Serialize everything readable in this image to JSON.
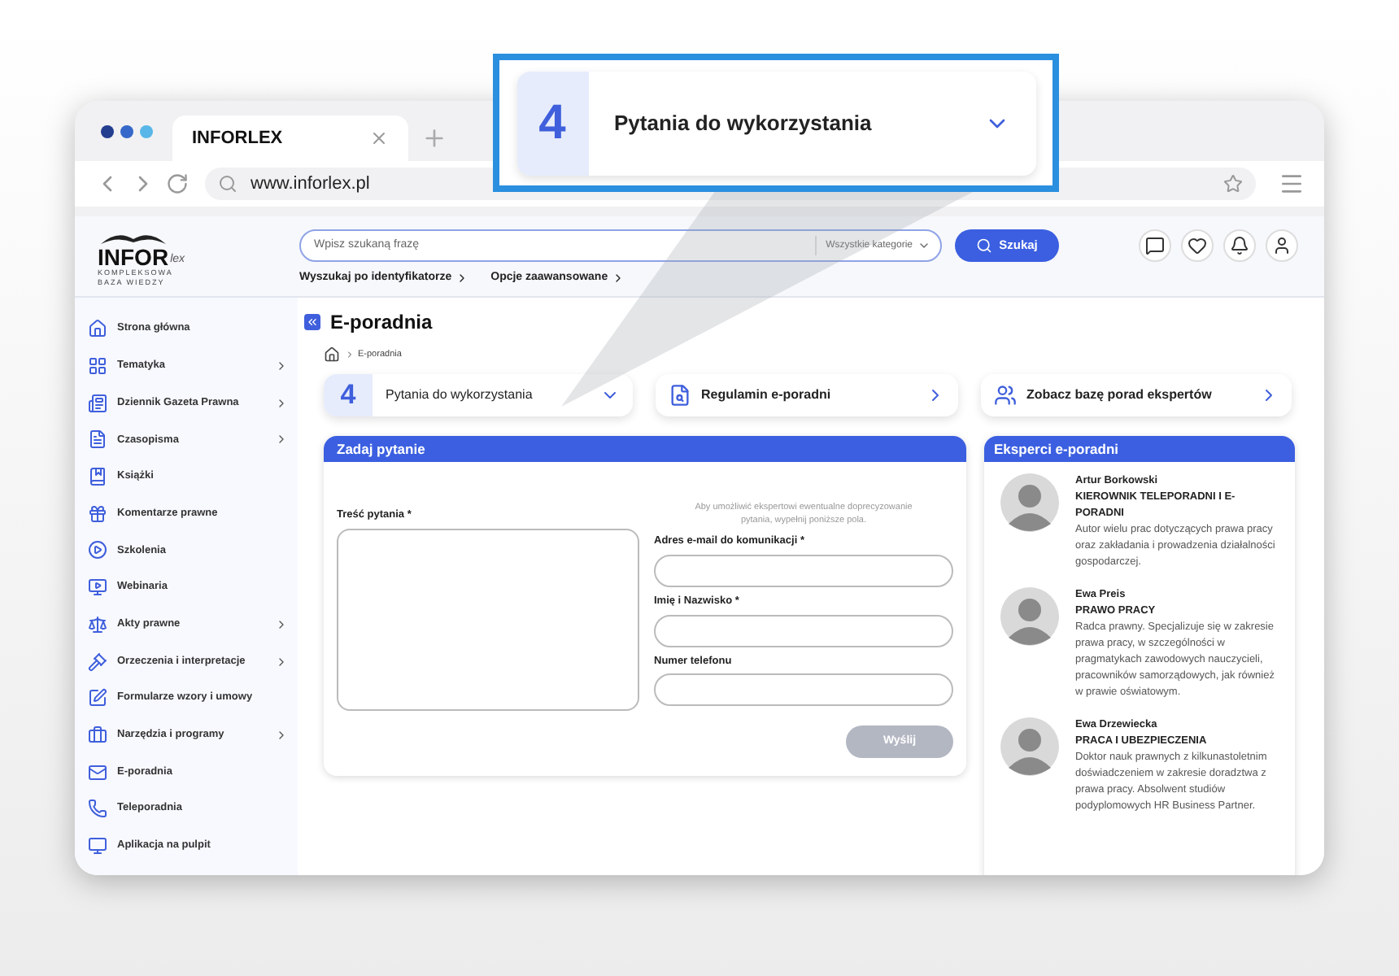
{
  "callout": {
    "number": "4",
    "label": "Pytania do wykorzystania"
  },
  "browser": {
    "tab_title": "INFORLEX",
    "url": "www.inforlex.pl"
  },
  "header": {
    "logo": {
      "name": "INFOR",
      "suffix": "lex",
      "tagline": [
        "KOMPLEKSOWA",
        "BAZA WIEDZY"
      ]
    },
    "search": {
      "placeholder": "Wpisz szukaną frazę",
      "category": "Wszystkie kategorie",
      "button": "Szukaj"
    },
    "links": [
      "Wyszukaj po identyfikatorze",
      "Opcje zaawansowane"
    ]
  },
  "sidebar": {
    "items": [
      {
        "label": "Strona główna",
        "has_children": false
      },
      {
        "label": "Tematyka",
        "has_children": true
      },
      {
        "label": "Dziennik Gazeta Prawna",
        "has_children": true
      },
      {
        "label": "Czasopisma",
        "has_children": true
      },
      {
        "label": "Książki",
        "has_children": false
      },
      {
        "label": "Komentarze prawne",
        "has_children": false
      },
      {
        "label": "Szkolenia",
        "has_children": false
      },
      {
        "label": "Webinaria",
        "has_children": false
      },
      {
        "label": "Akty prawne",
        "has_children": true
      },
      {
        "label": "Orzeczenia i interpretacje",
        "has_children": true
      },
      {
        "label": "Formularze wzory i umowy",
        "has_children": false
      },
      {
        "label": "Narzędzia i programy",
        "has_children": true
      },
      {
        "label": "E-poradnia",
        "has_children": false
      },
      {
        "label": "Teleporadnia",
        "has_children": false
      },
      {
        "label": "Aplikacja na pulpit",
        "has_children": false
      }
    ]
  },
  "page": {
    "title": "E-poradnia",
    "breadcrumb": [
      "E-poradnia"
    ]
  },
  "cards": [
    {
      "kind": "dropdown",
      "number": "4",
      "label": "Pytania do wykorzystania"
    },
    {
      "kind": "link",
      "label": "Regulamin e-poradni"
    },
    {
      "kind": "link",
      "label": "Zobacz bazę porad ekspertów"
    }
  ],
  "form": {
    "title": "Zadaj pytanie",
    "question_label": "Treść pytania *",
    "note": "Aby umożliwić ekspertowi ewentualne doprecyzowanie pytania, wypełnij poniższe pola.",
    "fields": [
      {
        "label": "Adres e-mail do komunikacji *"
      },
      {
        "label": "Imię i Nazwisko *"
      },
      {
        "label": "Numer telefonu"
      }
    ],
    "submit": {
      "label": "Wyślij",
      "disabled": true
    }
  },
  "experts": {
    "title": "Eksperci e-poradni",
    "items": [
      {
        "name": "Artur Borkowski",
        "role": "KIEROWNIK TELEPORADNI I E-PORADNI",
        "bio": "Autor wielu prac dotyczących prawa pracy oraz zakładania i prowadzenia działalności gospodarczej."
      },
      {
        "name": "Ewa Preis",
        "role": "PRAWO PRACY",
        "bio": "Radca prawny. Specjalizuje się w zakresie prawa pracy, w szczególności w pragmatykach zawodowych nauczycieli, pracowników samorządowych, jak również w prawie oświatowym."
      },
      {
        "name": "Ewa Drzewiecka",
        "role": "PRACA I UBEZPIECZENIA",
        "bio": "Doktor nauk prawnych z kilkunastoletnim doświadczeniem w zakresie doradztwa z prawa pracy. Absolwent studiów podyplomowych HR Business Partner."
      }
    ]
  }
}
